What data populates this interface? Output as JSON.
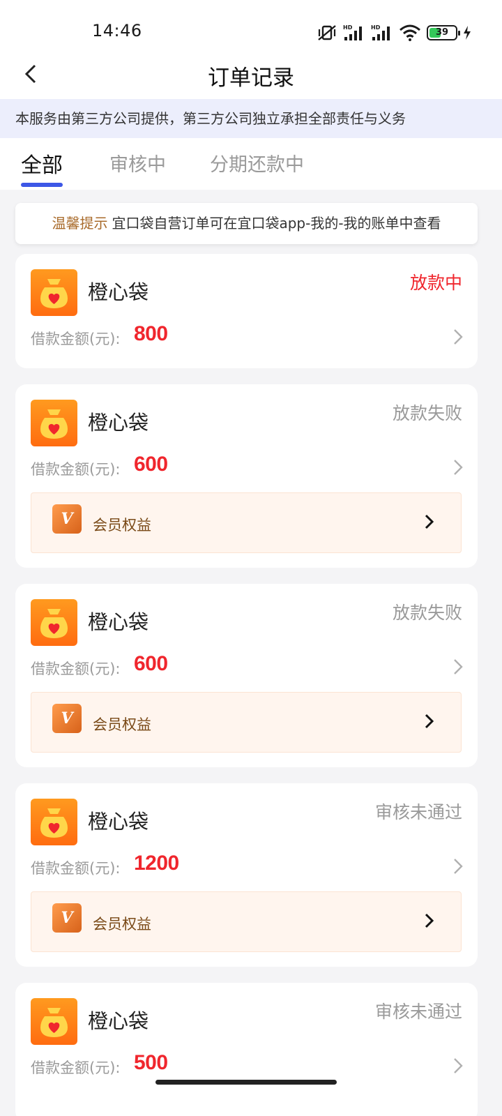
{
  "status_bar": {
    "time": "14:46",
    "battery": "39",
    "signal_label": "HD",
    "signal_label_2": "HD"
  },
  "nav": {
    "title": "订单记录"
  },
  "disclaimer": "本服务由第三方公司提供，第三方公司独立承担全部责任与义务",
  "tabs": [
    {
      "label": "全部",
      "active": true
    },
    {
      "label": "审核中",
      "active": false
    },
    {
      "label": "分期还款中",
      "active": false
    }
  ],
  "tip": {
    "label": "温馨提示",
    "text": "宜口袋自营订单可在宜口袋app-我的-我的账单中查看"
  },
  "amount_label": "借款金额(元):",
  "vip_label": "会员权益",
  "vip_icon_text": "V",
  "orders": [
    {
      "app_name": "橙心袋",
      "status": "放款中",
      "status_color": "#f0262d",
      "amount": "800",
      "has_vip": false
    },
    {
      "app_name": "橙心袋",
      "status": "放款失败",
      "status_color": "#9a9a9a",
      "amount": "600",
      "has_vip": true
    },
    {
      "app_name": "橙心袋",
      "status": "放款失败",
      "status_color": "#9a9a9a",
      "amount": "600",
      "has_vip": true
    },
    {
      "app_name": "橙心袋",
      "status": "审核未通过",
      "status_color": "#9a9a9a",
      "amount": "1200",
      "has_vip": true
    },
    {
      "app_name": "橙心袋",
      "status": "审核未通过",
      "status_color": "#9a9a9a",
      "amount": "500",
      "has_vip": false
    }
  ],
  "colors": {
    "accent": "#3d57e6",
    "amount": "#f0262d",
    "brand_orange": "#ff7a10"
  }
}
